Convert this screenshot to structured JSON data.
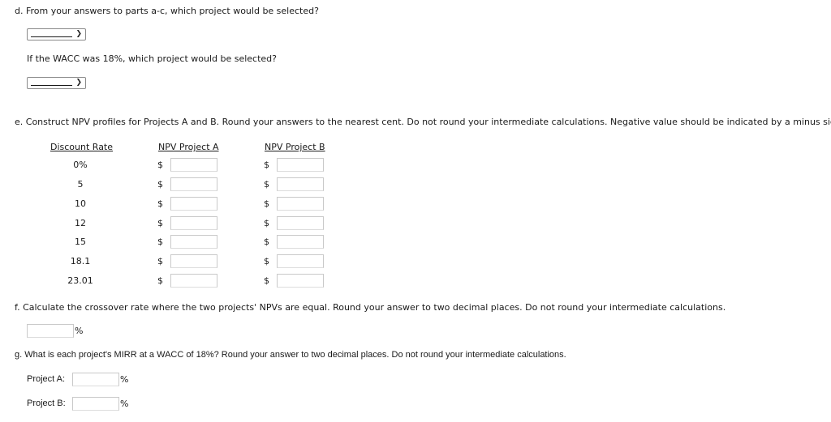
{
  "part_d": {
    "question": "d. From your answers to parts a-c, which project would be selected?",
    "select_1": {
      "value": "",
      "chevron_icon": "chevron-down-icon"
    },
    "sub_question": "If the WACC was 18%, which project would be selected?",
    "select_2": {
      "value": "",
      "chevron_icon": "chevron-down-icon"
    }
  },
  "part_e": {
    "question": "e. Construct NPV profiles for Projects A and B. Round your answers to the nearest cent. Do not round your intermediate calculations. Negative value should be indicated by a minus sign.",
    "headers": {
      "discount_rate": "Discount Rate",
      "npv_a": "NPV Project A",
      "npv_b": "NPV Project B"
    },
    "currency_symbol": "$",
    "rows": [
      {
        "rate": "0%",
        "npv_a": "",
        "npv_b": ""
      },
      {
        "rate": "5",
        "npv_a": "",
        "npv_b": ""
      },
      {
        "rate": "10",
        "npv_a": "",
        "npv_b": ""
      },
      {
        "rate": "12",
        "npv_a": "",
        "npv_b": ""
      },
      {
        "rate": "15",
        "npv_a": "",
        "npv_b": ""
      },
      {
        "rate": "18.1",
        "npv_a": "",
        "npv_b": ""
      },
      {
        "rate": "23.01",
        "npv_a": "",
        "npv_b": ""
      }
    ]
  },
  "part_f": {
    "question": "f. Calculate the crossover rate where the two projects' NPVs are equal. Round your answer to two decimal places. Do not round your intermediate calculations.",
    "value": "",
    "unit": "%"
  },
  "part_g": {
    "question": "g. What is each project's MIRR at a WACC of 18%? Round your answer to two decimal places. Do not round your intermediate calculations.",
    "project_a": {
      "label": "Project A:",
      "value": "",
      "unit": "%"
    },
    "project_b": {
      "label": "Project B:",
      "value": "",
      "unit": "%"
    }
  }
}
